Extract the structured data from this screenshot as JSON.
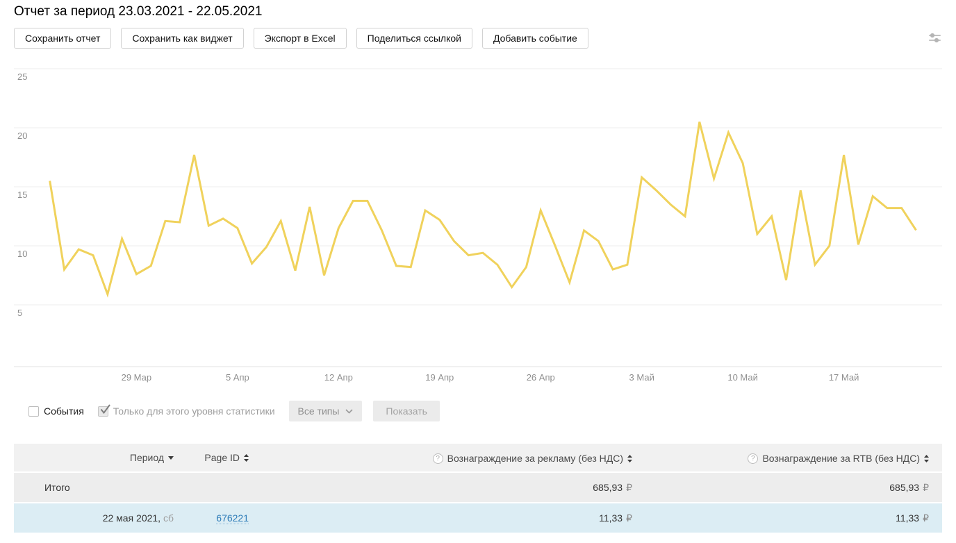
{
  "window": {
    "title": "Отчет за период 23.03.2021 - 22.05.2021"
  },
  "toolbar": {
    "buttons": [
      "Сохранить отчет",
      "Сохранить как виджет",
      "Экспорт в Excel",
      "Поделиться ссылкой",
      "Добавить событие"
    ]
  },
  "chart_data": {
    "type": "line",
    "title": "Отчет за период 23.03.2021 - 22.05.2021",
    "period_start": "23.03.2021",
    "period_end": "22.05.2021",
    "x_tick_labels": [
      "29 Мар",
      "5 Апр",
      "12 Апр",
      "19 Апр",
      "26 Апр",
      "3 Май",
      "10 Май",
      "17 Май"
    ],
    "x_tick_day_indices": [
      6,
      13,
      20,
      27,
      34,
      41,
      48,
      55
    ],
    "y_ticks": [
      5,
      10,
      15,
      20,
      25
    ],
    "ylim": [
      0,
      25.3
    ],
    "grid": true,
    "legend": "none",
    "line_color": "#f0d25c",
    "values": [
      15.5,
      8.0,
      9.7,
      9.2,
      5.9,
      10.6,
      7.6,
      8.3,
      12.1,
      12.0,
      17.7,
      11.7,
      12.3,
      11.5,
      8.5,
      9.9,
      12.1,
      7.9,
      13.3,
      7.5,
      11.5,
      13.8,
      13.8,
      11.3,
      8.3,
      8.2,
      13.0,
      12.2,
      10.4,
      9.2,
      9.4,
      8.4,
      6.5,
      8.2,
      13.0,
      10.0,
      6.9,
      11.3,
      10.4,
      8.0,
      8.4,
      15.8,
      14.7,
      13.5,
      12.5,
      20.5,
      15.7,
      19.6,
      17.0,
      11.0,
      12.5,
      7.1,
      14.7,
      8.4,
      10.0,
      17.7,
      10.1,
      14.2,
      13.2,
      13.2,
      11.33
    ]
  },
  "filters": {
    "events_label": "События",
    "events_checked": false,
    "level_label": "Только для этого уровня статистики",
    "level_checked": true,
    "types_dropdown_label": "Все типы",
    "show_button_label": "Показать"
  },
  "table": {
    "currency": "₽",
    "columns": [
      {
        "label": "Период",
        "sort": "desc"
      },
      {
        "label": "Page ID",
        "sort": "both"
      },
      {
        "label": "Вознаграждение за рекламу (без НДС)",
        "sort": "both",
        "help": true
      },
      {
        "label": "Вознаграждение за RTB (без НДС)",
        "sort": "both",
        "help": true
      }
    ],
    "total_row": {
      "label": "Итого",
      "ad_revenue": "685,93",
      "rtb_revenue": "685,93"
    },
    "rows": [
      {
        "period": "22 мая 2021,",
        "period_day": " сб",
        "page_id": "676221",
        "ad_revenue": "11,33",
        "rtb_revenue": "11,33"
      }
    ]
  },
  "colors": {
    "chart_line": "#f0d25c",
    "link": "#2e7cb8",
    "row_highlight_bg": "#dcedf4",
    "row_total_bg": "#ededed",
    "header_bg": "#f1f1f1"
  }
}
